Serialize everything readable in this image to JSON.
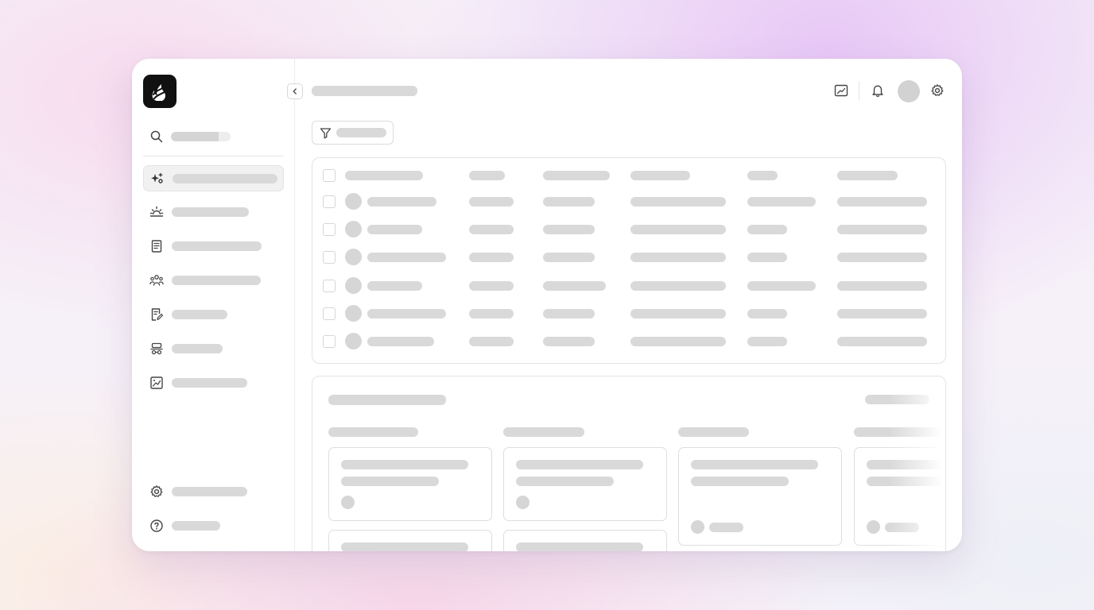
{
  "app": {
    "logo": "flame-logo",
    "state": "loading-skeleton"
  },
  "sidebar": {
    "search": {
      "icon": "search-icon"
    },
    "items": [
      {
        "icon": "sparkles-icon",
        "active": true
      },
      {
        "icon": "sunrise-icon",
        "active": false
      },
      {
        "icon": "document-list-icon",
        "active": false
      },
      {
        "icon": "team-icon",
        "active": false
      },
      {
        "icon": "document-edit-icon",
        "active": false
      },
      {
        "icon": "vehicle-icon",
        "active": false
      },
      {
        "icon": "chart-icon",
        "active": false
      }
    ],
    "footer": [
      {
        "icon": "gear-icon"
      },
      {
        "icon": "help-icon"
      }
    ]
  },
  "topbar": {
    "collapse": "chevron-left-icon",
    "actions": [
      "chart-icon",
      "bell-icon",
      "avatar",
      "gear-icon"
    ]
  },
  "toolbar": {
    "filter": "filter-icon"
  },
  "table": {
    "columns": 6,
    "rows": 6
  },
  "board": {
    "columns": 4
  },
  "colors": {
    "skeleton": "#d9d9d9",
    "border": "#e3e3e3",
    "surface": "#ffffff",
    "logo_bg": "#111111"
  }
}
